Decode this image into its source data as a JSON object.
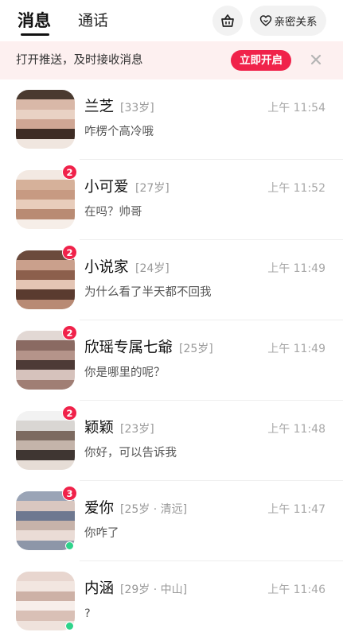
{
  "header": {
    "tabs": [
      {
        "label": "消息",
        "active": true
      },
      {
        "label": "通话",
        "active": false
      }
    ],
    "basket_icon": "basket-icon",
    "relation_button": {
      "icon": "heart-outline-icon",
      "label": "亲密关系"
    }
  },
  "banner": {
    "text": "打开推送，及时接收消息",
    "button_label": "立即开启",
    "close_icon": "close-icon"
  },
  "colors": {
    "accent": "#f0224a",
    "online": "#2fd38b",
    "banner_bg": "#fdf0f0"
  },
  "conversations": [
    {
      "name": "兰芝",
      "age": "[33岁]",
      "time": "上午 11:54",
      "message": "咋楞个高冷哦",
      "badge": "",
      "online": false,
      "palette": [
        "#4a3a30",
        "#d9b8a8",
        "#e9d2c4",
        "#cfa694",
        "#3e2c24",
        "#f0e6df"
      ]
    },
    {
      "name": "小可爱",
      "age": "[27岁]",
      "time": "上午 11:52",
      "message": "在吗？帅哥",
      "badge": "2",
      "online": false,
      "palette": [
        "#f3e9e2",
        "#d6b19a",
        "#c79a82",
        "#e8cdbb",
        "#b98b73",
        "#f6eee8"
      ]
    },
    {
      "name": "小说家",
      "age": "[24岁]",
      "time": "上午 11:49",
      "message": "为什么看了半天都不回我",
      "badge": "2",
      "online": false,
      "palette": [
        "#6b4a3c",
        "#caa08c",
        "#8c5f4c",
        "#e4c5b4",
        "#5a3b2f",
        "#b88a74"
      ]
    },
    {
      "name": "欣瑶专属七爺",
      "age": "[25岁]",
      "time": "上午 11:49",
      "message": "你是哪里的呢？",
      "badge": "2",
      "online": false,
      "palette": [
        "#e2d8d4",
        "#8a6a62",
        "#b5948a",
        "#4d3a36",
        "#d6c2bc",
        "#a07e74"
      ]
    },
    {
      "name": "颖颖",
      "age": "[23岁]",
      "time": "上午 11:48",
      "message": "你好，可以告诉我",
      "badge": "2",
      "online": false,
      "palette": [
        "#f2f2f2",
        "#d9d6d3",
        "#7c6a60",
        "#c4b4aa",
        "#3f3632",
        "#e6ddd6"
      ]
    },
    {
      "name": "爱你",
      "age": "[25岁 · 清远]",
      "time": "上午 11:47",
      "message": "你咋了",
      "badge": "3",
      "online": true,
      "palette": [
        "#9aa4b6",
        "#d9c7c0",
        "#6e7890",
        "#c7b3aa",
        "#eadcd6",
        "#8d96a8"
      ]
    },
    {
      "name": "内涵",
      "age": "[29岁 · 中山]",
      "time": "上午 11:46",
      "message": "?",
      "badge": "",
      "online": true,
      "palette": [
        "#e8d6cf",
        "#f2e6e0",
        "#cdb1a6",
        "#f7eeea",
        "#d9c0b6",
        "#efe2dc"
      ]
    }
  ]
}
